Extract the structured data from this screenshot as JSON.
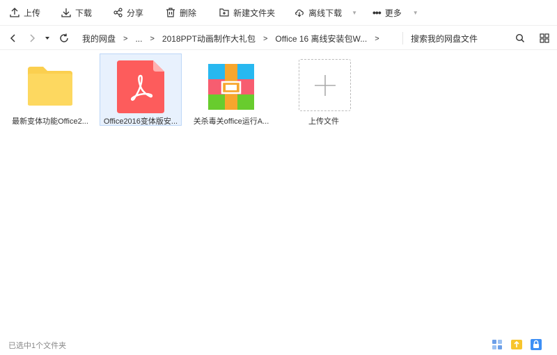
{
  "toolbar": {
    "upload": "上传",
    "download": "下载",
    "share": "分享",
    "delete": "删除",
    "new_folder": "新建文件夹",
    "offline_download": "离线下载",
    "more": "更多"
  },
  "navbar": {
    "breadcrumbs": [
      "我的网盘",
      "...",
      "2018PPT动画制作大礼包",
      "Office 16 离线安装包W..."
    ],
    "search_placeholder": "搜索我的网盘文件"
  },
  "files": [
    {
      "name": "最新变体功能Office2...",
      "type": "folder-icon"
    },
    {
      "name": "Office2016变体版安...",
      "type": "pdf-icon",
      "selected": true
    },
    {
      "name": "关杀毒关office运行A...",
      "type": "archive-icon"
    },
    {
      "name": "上传文件",
      "type": "upload-placeholder"
    }
  ],
  "status": {
    "text": "已选中1个文件夹"
  },
  "colors": {
    "folder": "#fdd860",
    "pdf": "#fd5c5c",
    "selection": "#e8f1fd",
    "accent_blue": "#3d8ff5"
  }
}
